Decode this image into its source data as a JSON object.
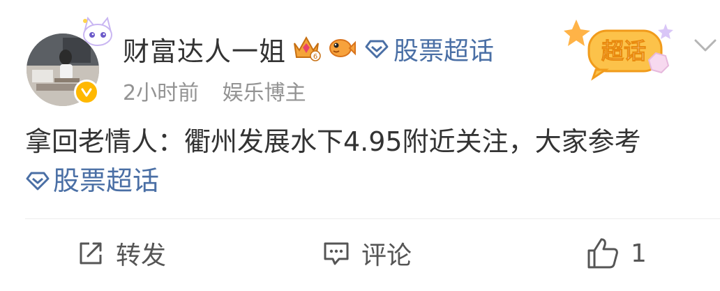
{
  "post": {
    "user": {
      "name": "财富达人一姐",
      "level": "6",
      "time": "2小时前",
      "role": "娱乐博主"
    },
    "header_topic": "股票超话",
    "supertopic_badge": "超话",
    "content": {
      "text": "拿回老情人：衢州发展水下4.95附近关注，大家参考",
      "topic": "股票超话"
    },
    "actions": {
      "repost_label": "转发",
      "comment_label": "评论",
      "like_count": "1"
    }
  },
  "colors": {
    "topic_blue": "#4a6fa5",
    "meta_gray": "#939393",
    "verified_gold": "#ffb800"
  },
  "icons": [
    "cat-decoration-icon",
    "verified-icon",
    "crown-level-icon",
    "fish-icon",
    "diamond-topic-icon",
    "supertopic-badge-icon",
    "chevron-down-icon",
    "repost-icon",
    "comment-icon",
    "like-icon"
  ]
}
